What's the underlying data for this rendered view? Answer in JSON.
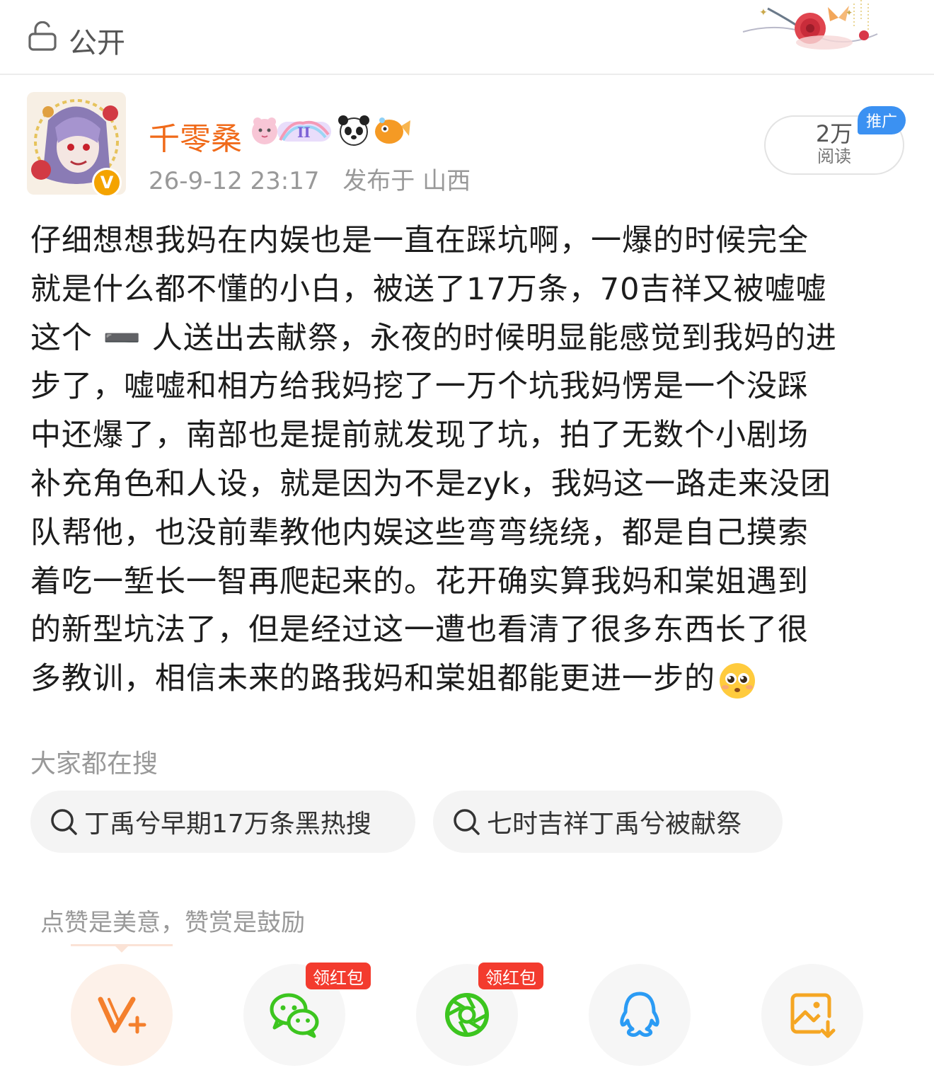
{
  "header": {
    "visibility_label": "公开",
    "lock_icon": "lock-open-icon",
    "decoration": "rose-butterfly-decoration"
  },
  "author": {
    "name": "千零桑",
    "badges": [
      "heart-bear-badge",
      "rainbow-level-badge",
      "panda-icon",
      "goldfish-icon"
    ],
    "timestamp": "26-9-12 23:17",
    "location": "发布于 山西",
    "verified_mark": "V"
  },
  "reads": {
    "count": "2万",
    "label": "阅读",
    "promo_label": "推广"
  },
  "post": {
    "lines": [
      "仔细想想我妈在内娱也是一直在踩坑啊，一爆的时候完全",
      "就是什么都不懂的小白，被送了17万条，70吉祥又被嘘嘘",
      "这个 ➖ 人送出去献祭，永夜的时候明显能感觉到我妈的进",
      "步了，嘘嘘和相方给我妈挖了一万个坑我妈愣是一个没踩",
      "中还爆了，南部也是提前就发现了坑，拍了无数个小剧场",
      "补充角色和人设，就是因为不是zyk，我妈这一路走来没团",
      "队帮他，也没前辈教他内娱这些弯弯绕绕，都是自己摸索",
      "着吃一堑长一智再爬起来的。花开确实算我妈和棠姐遇到",
      "的新型坑法了，但是经过这一遭也看清了很多东西长了很",
      "多教训，相信未来的路我妈和棠姐都能更进一步的"
    ],
    "trailing_emoji": "pleading-face-emoji"
  },
  "search": {
    "heading": "大家都在搜",
    "chips": [
      {
        "icon": "search-icon",
        "text": "丁禹兮早期17万条黑热搜"
      },
      {
        "icon": "search-icon",
        "text": "七时吉祥丁禹兮被献祭"
      }
    ]
  },
  "reward": {
    "hint": "点赞是美意，赞赏是鼓励"
  },
  "share": {
    "buttons": [
      {
        "icon": "v-plus-reward-icon",
        "badge": ""
      },
      {
        "icon": "wechat-icon",
        "badge": "领红包"
      },
      {
        "icon": "wechat-moments-icon",
        "badge": "领红包"
      },
      {
        "icon": "qq-icon",
        "badge": ""
      },
      {
        "icon": "save-image-icon",
        "badge": ""
      }
    ]
  },
  "colors": {
    "username": "#f06a19",
    "promo": "#3b91f2",
    "red_packet": "#f33b2e",
    "wechat": "#3cc51f",
    "qq": "#2b9bf4",
    "save": "#f5a623",
    "reward": "#f47f2c"
  }
}
